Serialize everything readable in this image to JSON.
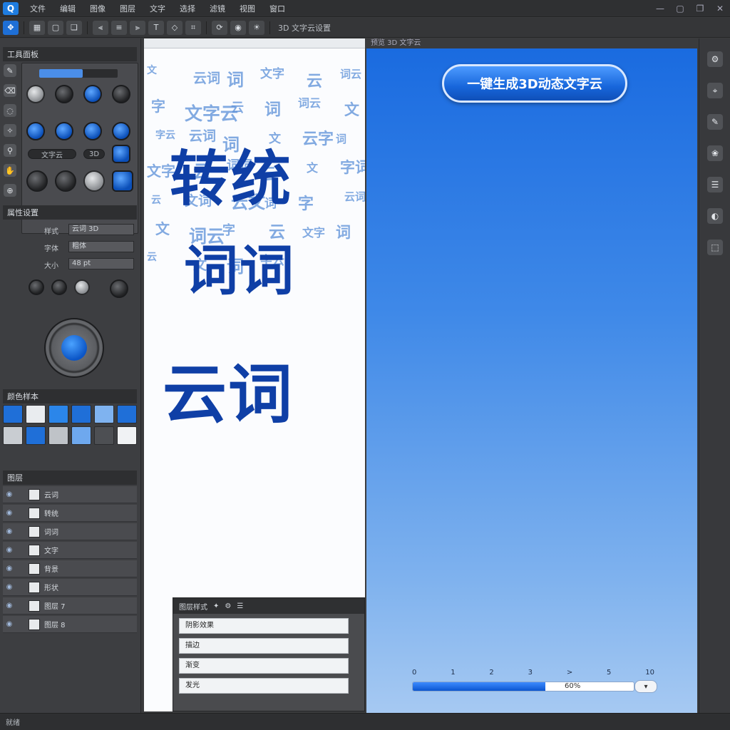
{
  "menubar": {
    "app_logo": "Q",
    "items": [
      "文件",
      "编辑",
      "图像",
      "图层",
      "文字",
      "选择",
      "滤镜",
      "视图",
      "窗口"
    ],
    "window_controls": [
      "—",
      "▢",
      "❐",
      "✕"
    ]
  },
  "toolbar": {
    "label": "3D 文字云设置"
  },
  "left_panel": {
    "header_tools": "工具面板",
    "header_props": "属性设置",
    "header_swatches": "颜色样本",
    "header_layers": "图层",
    "prop_labels": [
      "样式",
      "字体",
      "大小"
    ],
    "prop_values": [
      "云词 3D",
      "粗体",
      "48 pt"
    ],
    "slider_value": 0.55,
    "pill_left": "文字云",
    "pill_right": "3D",
    "layers": [
      "云词",
      "转统",
      "词词",
      "文字",
      "背景",
      "形状",
      "图层 7",
      "图层 8"
    ]
  },
  "swatches": {
    "colors": [
      "#1f6fd8",
      "#e9ecef",
      "#2b86ea",
      "#1f6fd8",
      "#7fb3f0",
      "#1f6fd8",
      "#c9cdd2",
      "#1f6fd8",
      "#bfc3c8",
      "#6ea8ee",
      "#4d4f53",
      "#f0f2f4"
    ]
  },
  "canvas": {
    "big_words": [
      "转统",
      "词词",
      "云词"
    ],
    "bg_words": [
      "文",
      "云词",
      "词",
      "文字",
      "云",
      "词云",
      "字",
      "文字云",
      "云",
      "词",
      "词云",
      "文",
      "字云",
      "云词",
      "词",
      "文",
      "云字",
      "词",
      "文字",
      "云",
      "词词",
      "云",
      "文",
      "字词",
      "云",
      "文词",
      "云文",
      "词",
      "字",
      "云词",
      "文",
      "词云",
      "字",
      "云",
      "文字",
      "词",
      "云",
      "文",
      "词",
      "字云"
    ]
  },
  "mini_panel": {
    "title": "图层样式",
    "rows": [
      "阴影效果",
      "描边",
      "渐变",
      "发光"
    ]
  },
  "preview": {
    "ruler_label": "预览 3D 文字云",
    "generate_button": "一键生成3D动态文字云",
    "timeline_labels": [
      "0",
      "1",
      "2",
      "3",
      ">",
      "5",
      "10"
    ],
    "progress": 0.6,
    "progress_value": "60%",
    "dropdown_glyph": "▾"
  },
  "right_strip": {
    "icons": [
      "⚙",
      "⌖",
      "✎",
      "❀",
      "☰",
      "◐",
      "⬚"
    ]
  },
  "status": {
    "text": "就绪"
  }
}
